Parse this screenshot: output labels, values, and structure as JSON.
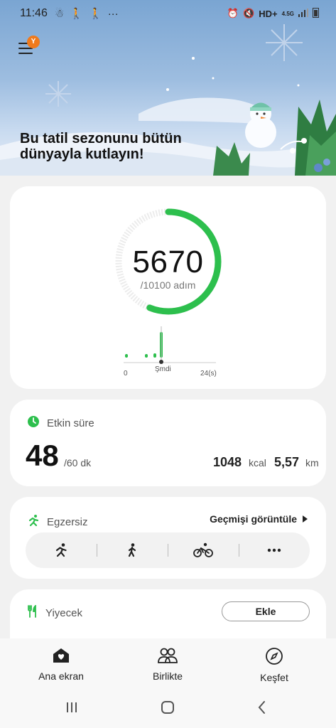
{
  "status_bar": {
    "time": "11:46",
    "right_text": "HD+",
    "network": "4.5G"
  },
  "banner": {
    "title": "Bu tatil sezonunu bütün dünyayla kutlayın!",
    "menu_badge": "Y"
  },
  "steps": {
    "count": "5670",
    "goal": "/10100 adım",
    "progress": 0.561,
    "chart_labels": {
      "start": "0",
      "now": "Şmdi",
      "end": "24(s)"
    }
  },
  "active_time": {
    "title": "Etkin süre",
    "minutes": "48",
    "goal": "/60 dk",
    "kcal_value": "1048",
    "kcal_unit": "kcal",
    "km_value": "5,57",
    "km_unit": "km"
  },
  "exercise": {
    "title": "Egzersiz",
    "history_label": "Geçmişi görüntüle",
    "items": [
      "running-icon",
      "walking-icon",
      "cycling-icon",
      "more-icon"
    ]
  },
  "food": {
    "title": "Yiyecek",
    "add_label": "Ekle"
  },
  "bottom_nav": {
    "home": "Ana ekran",
    "together": "Birlikte",
    "discover": "Keşfet"
  },
  "colors": {
    "accent_green": "#2dbf4d",
    "badge_orange": "#f07a1c"
  }
}
